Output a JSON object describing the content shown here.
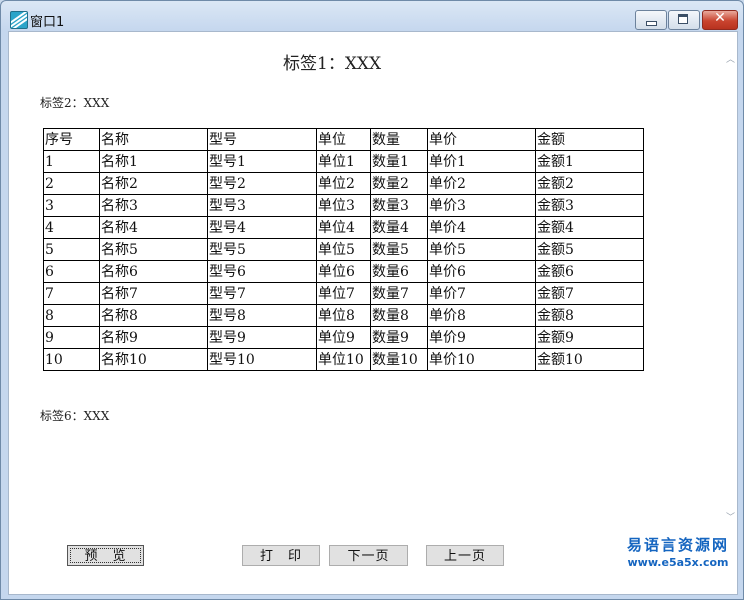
{
  "window": {
    "title": "窗口1",
    "close_glyph": "✕"
  },
  "report": {
    "title": "标签1：XXX",
    "label2": "标签2：XXX",
    "label6": "标签6：XXX",
    "columns": [
      "序号",
      "名称",
      "型号",
      "单位",
      "数量",
      "单价",
      "金额"
    ],
    "rows": [
      [
        "1",
        "名称1",
        "型号1",
        "单位1",
        "数量1",
        "单价1",
        "金额1"
      ],
      [
        "2",
        "名称2",
        "型号2",
        "单位2",
        "数量2",
        "单价2",
        "金额2"
      ],
      [
        "3",
        "名称3",
        "型号3",
        "单位3",
        "数量3",
        "单价3",
        "金额3"
      ],
      [
        "4",
        "名称4",
        "型号4",
        "单位4",
        "数量4",
        "单价4",
        "金额4"
      ],
      [
        "5",
        "名称5",
        "型号5",
        "单位5",
        "数量5",
        "单价5",
        "金额5"
      ],
      [
        "6",
        "名称6",
        "型号6",
        "单位6",
        "数量6",
        "单价6",
        "金额6"
      ],
      [
        "7",
        "名称7",
        "型号7",
        "单位7",
        "数量7",
        "单价7",
        "金额7"
      ],
      [
        "8",
        "名称8",
        "型号8",
        "单位8",
        "数量8",
        "单价8",
        "金额8"
      ],
      [
        "9",
        "名称9",
        "型号9",
        "单位9",
        "数量9",
        "单价9",
        "金额9"
      ],
      [
        "10",
        "名称10",
        "型号10",
        "单位10",
        "数量10",
        "单价10",
        "金额10"
      ]
    ]
  },
  "buttons": {
    "preview": "预　览",
    "print": "打　印",
    "next": "下一页",
    "prev": "上一页"
  },
  "scroll": {
    "up_glyph": "︿",
    "down_glyph": "﹀"
  },
  "watermark": {
    "line1": "易语言资源网",
    "line2": "www.e5a5x.com"
  },
  "icons": {
    "app": "app-icon",
    "minimize": "minimize-icon",
    "maximize": "maximize-icon",
    "close": "close-icon"
  },
  "colors": {
    "watermark": "#1565c0",
    "close_button": "#c9442f",
    "frame": "#c5d7ee"
  }
}
